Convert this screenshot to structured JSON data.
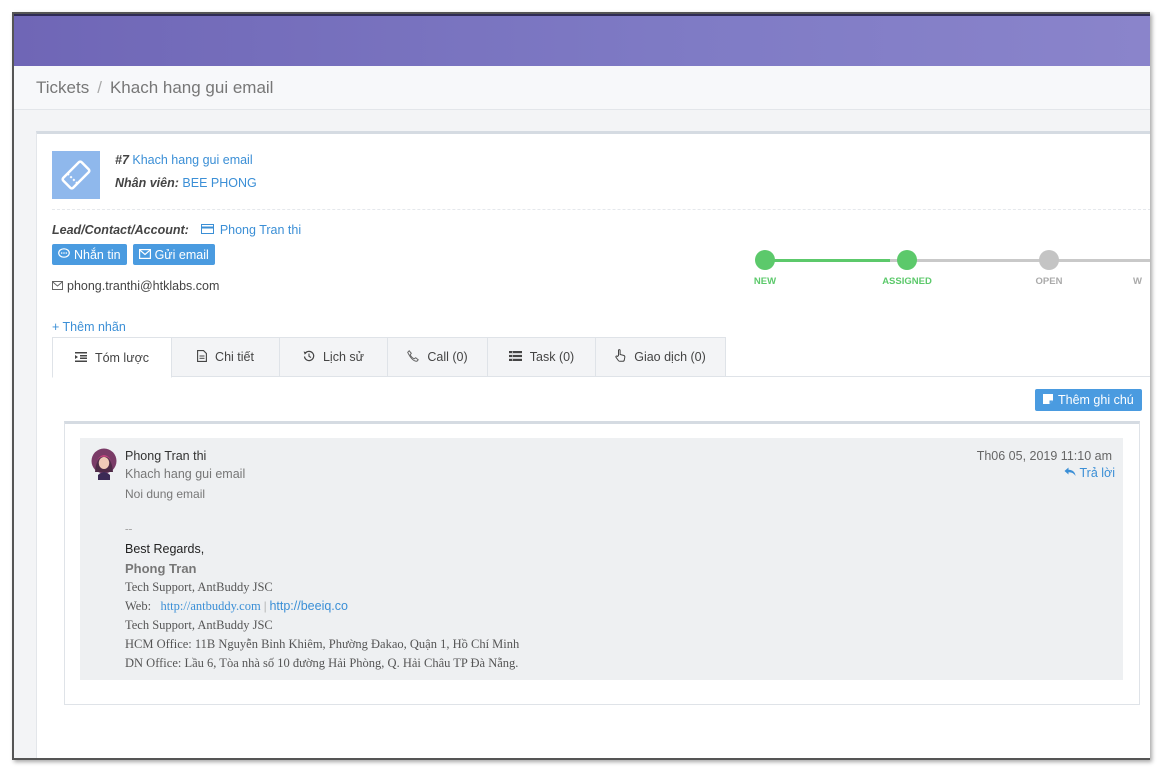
{
  "breadcrumb": {
    "root": "Tickets",
    "separator": "/",
    "current": "Khach hang gui email"
  },
  "ticket": {
    "number": "#7",
    "title": "Khach hang gui email",
    "staff_label": "Nhân viên:",
    "staff_name": "BEE PHONG"
  },
  "lead": {
    "label": "Lead/Contact/Account:",
    "name": "Phong Tran thi",
    "email": "phong.tranthi@htklabs.com"
  },
  "actions": {
    "message": "Nhắn tin",
    "send_email": "Gửi email",
    "add_tag": "+ Thêm nhãn",
    "add_note": "Thêm ghi chú"
  },
  "pipeline": {
    "stages": [
      "NEW",
      "ASSIGNED",
      "OPEN",
      "W"
    ],
    "active_color": "#5cc96b",
    "inactive_color": "#c4c4c4"
  },
  "tabs": [
    {
      "label": "Tóm lược",
      "icon": "indent-icon"
    },
    {
      "label": "Chi tiết",
      "icon": "document-icon"
    },
    {
      "label": "Lịch sử",
      "icon": "history-icon"
    },
    {
      "label": "Call (0)",
      "icon": "phone-icon"
    },
    {
      "label": "Task (0)",
      "icon": "tasks-icon"
    },
    {
      "label": "Giao dịch (0)",
      "icon": "hand-icon"
    }
  ],
  "message": {
    "from": "Phong Tran thi",
    "subject": "Khach hang gui email",
    "body": "Noi dung email",
    "time": "Th06 05, 2019 11:10 am",
    "reply": "Trả lời",
    "signature": {
      "dash": "--",
      "regards": "Best Regards,",
      "name": "Phong Tran",
      "title1": "Tech Support, AntBuddy JSC",
      "web_label": "Web:",
      "web1": "http://antbuddy.com",
      "web_sep": "|",
      "web2": "http://beeiq.co",
      "title2": "Tech Support, AntBuddy JSC",
      "hcm": "HCM Office: 11B Nguyễn Bỉnh Khiêm, Phường Đakao, Quận 1, Hồ Chí Minh",
      "dn": "DN Office: Lầu 6,  Tòa nhà số 10 đường Hải Phòng, Q. Hải Châu TP Đà Nẵng."
    }
  }
}
